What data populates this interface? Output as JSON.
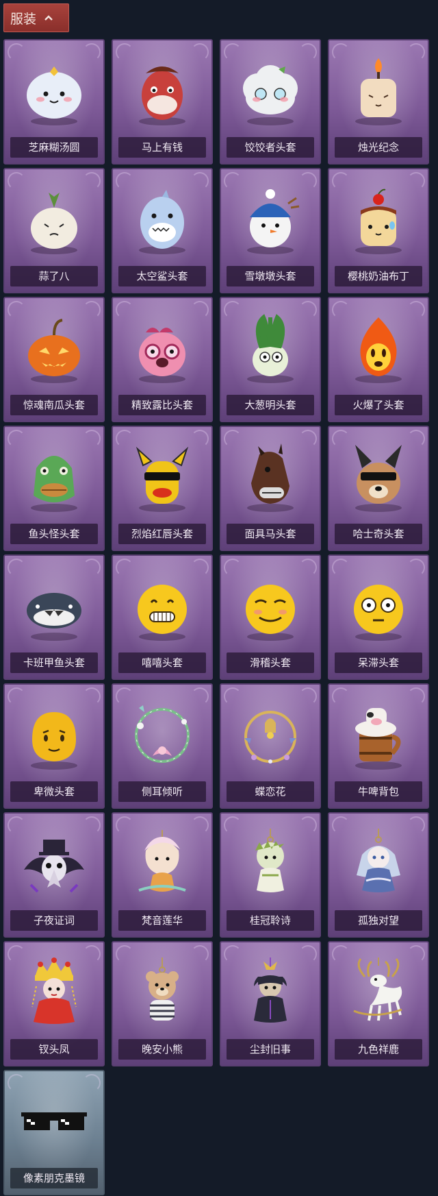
{
  "header": {
    "tab_label": "服装",
    "tab_icon": "chevron-up-icon"
  },
  "items": [
    {
      "label": "芝麻糊汤圆",
      "icon": "rice-ball-mascot-icon",
      "color": "#e8eef8",
      "accent": "#f2c23a"
    },
    {
      "label": "马上有钱",
      "icon": "red-horse-head-icon",
      "color": "#c8403c",
      "accent": "#f5e6e0"
    },
    {
      "label": "饺饺者头套",
      "icon": "dumpling-cloud-head-icon",
      "color": "#eef0f2",
      "accent": "#5fa84a"
    },
    {
      "label": "烛光纪念",
      "icon": "candle-head-icon",
      "color": "#f2dcc0",
      "accent": "#ff8a2a"
    },
    {
      "label": "蒜了八",
      "icon": "garlic-head-icon",
      "color": "#f2ece0",
      "accent": "#5c8f3c"
    },
    {
      "label": "太空鲨头套",
      "icon": "space-shark-head-icon",
      "color": "#b9d0ef",
      "accent": "#ffffff"
    },
    {
      "label": "雪墩墩头套",
      "icon": "snowman-beanie-head-icon",
      "color": "#f4f4f4",
      "accent": "#2b62b8"
    },
    {
      "label": "樱桃奶油布丁",
      "icon": "cherry-pudding-head-icon",
      "color": "#f3d79a",
      "accent": "#8a3a1c"
    },
    {
      "label": "惊魂南瓜头套",
      "icon": "pumpkin-head-icon",
      "color": "#e8701e",
      "accent": "#ffd86a"
    },
    {
      "label": "精致露比头套",
      "icon": "pink-glasses-head-icon",
      "color": "#ef8fb0",
      "accent": "#c23a6a"
    },
    {
      "label": "大葱明头套",
      "icon": "scallion-head-icon",
      "color": "#e8f0d8",
      "accent": "#3f8a3a"
    },
    {
      "label": "火爆了头套",
      "icon": "fireball-head-icon",
      "color": "#f05a14",
      "accent": "#ffd23a"
    },
    {
      "label": "鱼头怪头套",
      "icon": "fish-head-mask-icon",
      "color": "#5aa856",
      "accent": "#c98a3e"
    },
    {
      "label": "烈焰红唇头套",
      "icon": "yellow-ski-mask-icon",
      "color": "#f0c418",
      "accent": "#d8301c"
    },
    {
      "label": "面具马头套",
      "icon": "horse-mask-icon",
      "color": "#5a3222",
      "accent": "#2a1a12"
    },
    {
      "label": "哈士奇头套",
      "icon": "dog-sunglasses-head-icon",
      "color": "#c89060",
      "accent": "#2a2a2a"
    },
    {
      "label": "卡班甲鱼头套",
      "icon": "turtle-head-icon",
      "color": "#3a4658",
      "accent": "#f0f0f0"
    },
    {
      "label": "嘻嘻头套",
      "icon": "grinning-emoji-head-icon",
      "color": "#f7c81e",
      "accent": "#3a2a10"
    },
    {
      "label": "滑稽头套",
      "icon": "smirk-emoji-head-icon",
      "color": "#f7c81e",
      "accent": "#3a2a10"
    },
    {
      "label": "呆滞头套",
      "icon": "dazed-emoji-head-icon",
      "color": "#f7c81e",
      "accent": "#3a2a10"
    },
    {
      "label": "卑微头套",
      "icon": "humble-emoji-head-icon",
      "color": "#f2b81a",
      "accent": "#3a2a10"
    },
    {
      "label": "侧耳倾听",
      "icon": "lotus-wreath-icon",
      "color": "#f0a8c8",
      "accent": "#8fd0c8"
    },
    {
      "label": "蝶恋花",
      "icon": "butterfly-flower-ring-icon",
      "color": "#d9b45a",
      "accent": "#7a8fd0"
    },
    {
      "label": "牛啤背包",
      "icon": "cow-beer-mug-icon",
      "color": "#a8622c",
      "accent": "#f4f0ec"
    },
    {
      "label": "子夜证词",
      "icon": "crow-plague-doctor-icon",
      "color": "#2a2438",
      "accent": "#7a3ac0"
    },
    {
      "label": "梵音莲华",
      "icon": "lotus-girl-charm-icon",
      "color": "#f4e0d0",
      "accent": "#e8a24a"
    },
    {
      "label": "桂冠聆诗",
      "icon": "laurel-doll-charm-icon",
      "color": "#e0e8c8",
      "accent": "#8aa84a"
    },
    {
      "label": "孤独对望",
      "icon": "silver-doll-charm-icon",
      "color": "#c8d4ea",
      "accent": "#5a70b0"
    },
    {
      "label": "钗头凤",
      "icon": "phoenix-crown-doll-icon",
      "color": "#d8342a",
      "accent": "#f0c83a"
    },
    {
      "label": "晚安小熊",
      "icon": "bear-charm-icon",
      "color": "#d8b088",
      "accent": "#3a3a4a"
    },
    {
      "label": "尘封旧事",
      "icon": "dark-hair-doll-charm-icon",
      "color": "#2a2a3a",
      "accent": "#d8c8b0"
    },
    {
      "label": "九色祥鹿",
      "icon": "white-deer-charm-icon",
      "color": "#f4f4f0",
      "accent": "#c8a24a"
    },
    {
      "label": "像素朋克墨镜",
      "icon": "pixel-sunglasses-icon",
      "color": "#111111",
      "accent": "#ffffff"
    }
  ]
}
